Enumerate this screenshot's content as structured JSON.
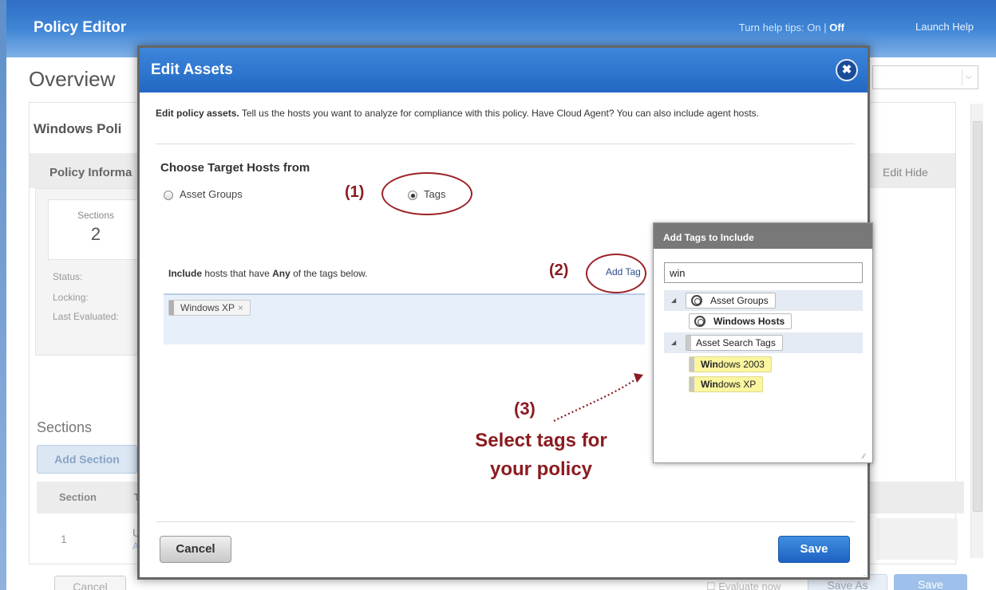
{
  "app": {
    "title": "Policy Editor",
    "help_tips_prefix": "Turn help tips: ",
    "help_tips_on": "On",
    "help_tips_sep": " | ",
    "help_tips_off": "Off",
    "launch_help": "Launch Help",
    "overview": "Overview",
    "policy_name": "Windows Poli",
    "policy_info": "Policy Informa",
    "edit_hide": "Edit  Hide",
    "sections_card_label": "Sections",
    "sections_card_value": "2",
    "status_label": "Status:",
    "locking_label": "Locking:",
    "last_evaluated_label": "Last Evaluated:",
    "sections_heading": "Sections",
    "add_section": "Add Section",
    "table_header_section": "Section",
    "table_header_title": "Ti",
    "row_number": "1",
    "row_title_fragment": "U",
    "row_sub_fragment": "A",
    "cancel": "Cancel",
    "evaluate_now": "Evaluate now",
    "save_as": "Save As",
    "save": "Save"
  },
  "modal": {
    "title": "Edit Assets",
    "close_glyph": "✖",
    "intro_bold": "Edit policy assets.",
    "intro_text": " Tell us the hosts you want to analyze for compliance with this policy. Have Cloud Agent? You can also include agent hosts.",
    "choose_label": "Choose Target Hosts from",
    "option_asset_groups": "Asset Groups",
    "option_tags": "Tags",
    "selected_option": "Tags",
    "include_prefix": "Include",
    "include_middle": " hosts that have ",
    "include_any": "Any",
    "include_suffix": " of the tags below.",
    "add_tag": "Add Tag",
    "selected_tags": [
      "Windows XP"
    ],
    "tag_remove_glyph": "×",
    "cancel": "Cancel",
    "save": "Save"
  },
  "annotations": {
    "step1": "(1)",
    "step2": "(2)",
    "step3": "(3)",
    "step3_caption_line1": "Select tags for",
    "step3_caption_line2": "your policy"
  },
  "picker": {
    "title": "Add Tags to Include",
    "search_value": "win",
    "groups": [
      {
        "label": "Asset Groups",
        "children": [
          {
            "label": "Windows Hosts",
            "match": "Win",
            "rest": "dows Hosts"
          }
        ]
      },
      {
        "label": "Asset Search Tags",
        "children": [
          {
            "label": "Windows 2003",
            "match": "Win",
            "rest": "dows 2003"
          },
          {
            "label": "Windows XP",
            "match": "Win",
            "rest": "dows XP"
          }
        ]
      }
    ]
  },
  "colors": {
    "header_blue": "#2f6fc4",
    "annotation_red": "#8b1b20",
    "highlight_yellow": "#fbf6a0",
    "save_blue": "#1f62c1"
  }
}
